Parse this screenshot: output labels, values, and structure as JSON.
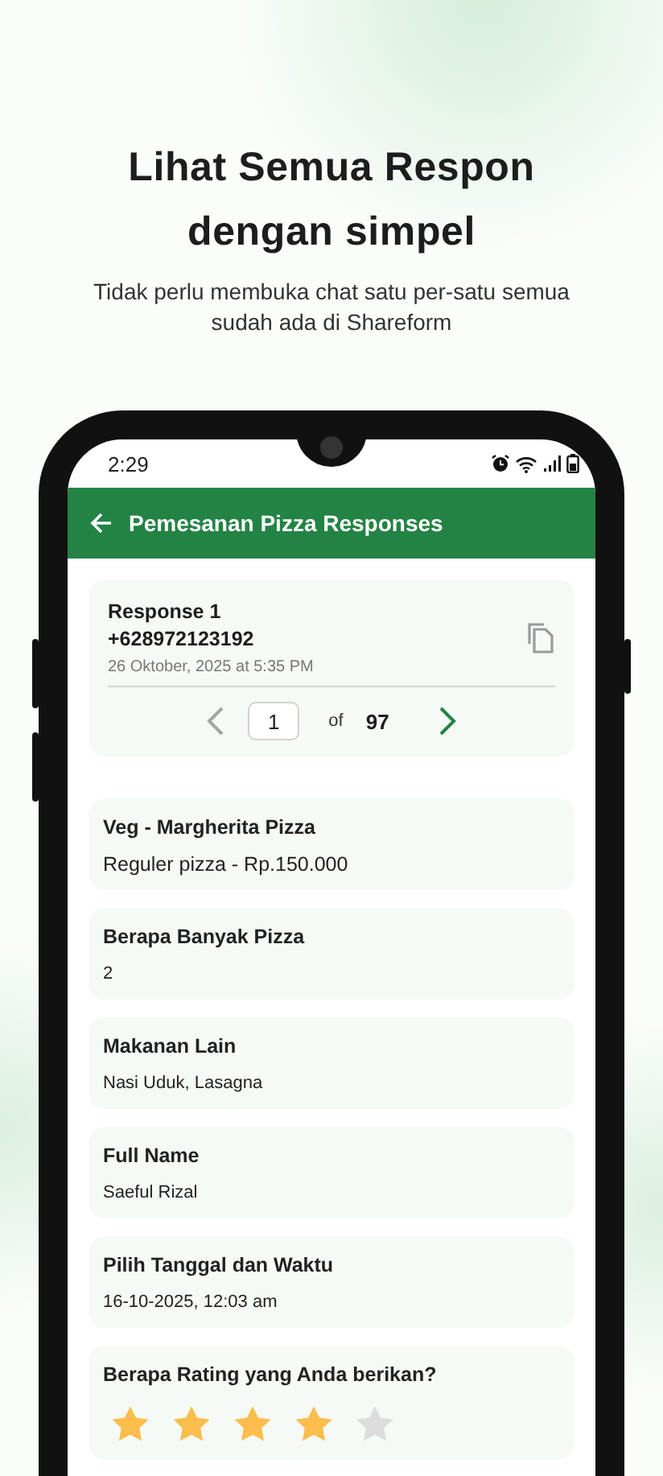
{
  "headline": "Lihat Semua Respon dengan simpel",
  "subtitle": "Tidak perlu membuka chat satu per-satu semua sudah ada di Shareform",
  "status_bar": {
    "time": "2:29"
  },
  "app_bar": {
    "title": "Pemesanan Pizza Responses"
  },
  "response": {
    "label": "Response 1",
    "phone": "+628972123192",
    "timestamp": "26 Oktober, 2025 at 5:35 PM",
    "pager": {
      "page": "1",
      "of": "of",
      "total": "97",
      "prev_disabled": true,
      "next_disabled": false
    }
  },
  "answers": [
    {
      "kind": "text",
      "question": "Veg - Margherita Pizza",
      "answer": "Reguler pizza - Rp.150.000"
    },
    {
      "kind": "text",
      "question": "Berapa Banyak Pizza",
      "answer": "2"
    },
    {
      "kind": "text",
      "question": "Makanan Lain",
      "answer": "Nasi Uduk, Lasagna"
    },
    {
      "kind": "text",
      "question": "Full Name",
      "answer": "Saeful Rizal"
    },
    {
      "kind": "text",
      "question": "Pilih Tanggal dan Waktu",
      "answer": "16-10-2025, 12:03 am"
    },
    {
      "kind": "rating",
      "question": "Berapa Rating yang Anda berikan?",
      "stars": 4
    }
  ]
}
